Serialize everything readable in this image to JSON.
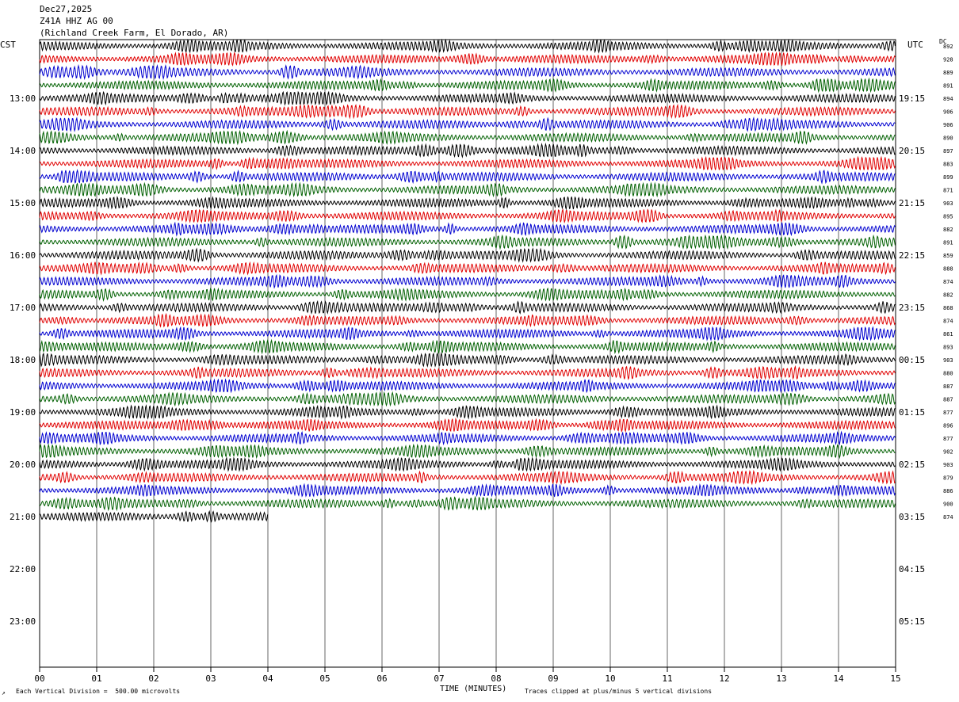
{
  "header": {
    "date": "Dec27,2025",
    "station": "Z41A HHZ AG 00",
    "location": "(Richland Creek Farm, El Dorado, AR)"
  },
  "axis_labels": {
    "left_tz": "CST",
    "right_tz": "UTC",
    "dc_label": "DC",
    "xlabel": "TIME (MINUTES)"
  },
  "footer": {
    "scale_note": "Each Vertical Division =  500.00 microvolts",
    "clip_note": "Traces clipped at plus/minus 5 vertical divisions",
    "corner_mark": "↗"
  },
  "chart_data": {
    "type": "line",
    "title": "Z41A HHZ AG 00",
    "xlabel": "TIME (MINUTES)",
    "xlim": [
      0,
      15
    ],
    "x_ticks": [
      "00",
      "01",
      "02",
      "03",
      "04",
      "05",
      "06",
      "07",
      "08",
      "09",
      "10",
      "11",
      "12",
      "13",
      "14",
      "15"
    ],
    "rows_per_hour": 4,
    "left_hour_labels": [
      "13:00",
      "14:00",
      "15:00",
      "16:00",
      "17:00",
      "18:00",
      "19:00",
      "20:00",
      "21:00",
      "22:00",
      "23:00"
    ],
    "right_hour_labels": [
      "19:15",
      "20:15",
      "21:15",
      "22:15",
      "23:15",
      "00:15",
      "01:15",
      "02:15",
      "03:15",
      "04:15",
      "05:15"
    ],
    "trace_colors": [
      "#000000",
      "#e00000",
      "#0000d0",
      "#006000"
    ],
    "trace_dc_offsets": [
      892,
      928,
      889,
      891,
      894,
      906,
      906,
      890,
      897,
      883,
      899,
      871,
      903,
      895,
      882,
      891,
      859,
      888,
      874,
      882,
      868,
      874,
      861,
      893,
      903,
      880,
      887,
      887,
      877,
      896,
      877,
      902,
      903,
      879,
      886,
      900,
      874
    ],
    "last_trace_end_minute": 4.0,
    "scale_microvolts_per_division": 500.0,
    "clip_divisions": 5
  }
}
